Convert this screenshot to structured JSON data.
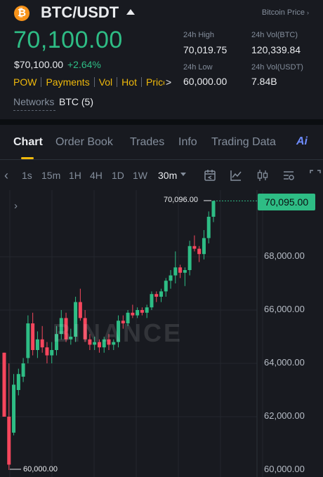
{
  "header": {
    "coin_icon_glyph": "₿",
    "pair": "BTC/USDT",
    "index_label": "Bitcoin Price",
    "last_price": "70,100.00",
    "fiat_price": "$70,100.00",
    "change": "+2.64%",
    "tags": [
      "POW",
      "Payments",
      "Vol",
      "Hot",
      "Price P"
    ],
    "networks_label": "Networks",
    "networks_value": "BTC (5)"
  },
  "stats": {
    "high_label": "24h High",
    "high": "70,019.75",
    "vol_btc_label": "24h Vol(BTC)",
    "vol_btc": "120,339.84",
    "low_label": "24h Low",
    "low": "60,000.00",
    "vol_usdt_label": "24h Vol(USDT)",
    "vol_usdt": "7.84B"
  },
  "tabs": [
    "Chart",
    "Order Book",
    "Trades",
    "Info",
    "Trading Data"
  ],
  "active_tab": "Chart",
  "ai_label": "Ai",
  "timeframes": [
    "1s",
    "15m",
    "1H",
    "4H",
    "1D",
    "1W",
    "30m"
  ],
  "selected_timeframe": "30m",
  "toolbar_icons": [
    "chevron-left-icon",
    "calendar-icon",
    "indicator-icon",
    "candle-type-icon",
    "settings-icon",
    "fullscreen-icon"
  ],
  "colors": {
    "up": "#2ebd85",
    "down": "#f6465d",
    "accent": "#f0b90b",
    "bg": "#181a20"
  },
  "watermark": "BINANCE",
  "chart_data": {
    "type": "candlestick",
    "y_ticks": [
      "68,000.00",
      "66,000.00",
      "64,000.00",
      "62,000.00",
      "60,000.00"
    ],
    "ylim": [
      60000,
      70400
    ],
    "current_price": "70,095.00",
    "high_annotation": "70,096.00",
    "low_annotation": "60,000.00",
    "candles": [
      [
        64400,
        64400,
        62800,
        62000
      ],
      [
        62000,
        64000,
        60000,
        60200
      ],
      [
        61400,
        63600,
        61300,
        63200
      ],
      [
        63000,
        63800,
        62800,
        63600
      ],
      [
        63500,
        64200,
        63300,
        64000
      ],
      [
        64200,
        65800,
        64000,
        65500
      ],
      [
        65500,
        65900,
        64300,
        64500
      ],
      [
        64500,
        65200,
        64200,
        64900
      ],
      [
        64900,
        65400,
        64400,
        64600
      ],
      [
        64600,
        64800,
        64000,
        64300
      ],
      [
        64300,
        64800,
        64000,
        64500
      ],
      [
        64500,
        65400,
        64300,
        65100
      ],
      [
        65100,
        66000,
        64900,
        65700
      ],
      [
        65700,
        65900,
        64800,
        64900
      ],
      [
        64900,
        65300,
        64700,
        65000
      ],
      [
        65000,
        66500,
        64800,
        66300
      ],
      [
        66300,
        66800,
        65600,
        65700
      ],
      [
        65700,
        66000,
        64800,
        64900
      ],
      [
        64900,
        65100,
        64500,
        64700
      ],
      [
        64700,
        65000,
        64500,
        64800
      ],
      [
        64800,
        64900,
        64400,
        64600
      ],
      [
        64600,
        65000,
        64400,
        64900
      ],
      [
        64900,
        65100,
        64500,
        64700
      ],
      [
        64700,
        64900,
        64500,
        64800
      ],
      [
        64800,
        65800,
        64600,
        65600
      ],
      [
        65600,
        65800,
        65300,
        65500
      ],
      [
        65500,
        66000,
        65400,
        65900
      ],
      [
        65900,
        66200,
        65700,
        65800
      ],
      [
        65800,
        66100,
        65700,
        66000
      ],
      [
        66000,
        66100,
        65800,
        65900
      ],
      [
        65900,
        66200,
        65700,
        66100
      ],
      [
        66100,
        66700,
        66000,
        66600
      ],
      [
        66600,
        66700,
        66300,
        66500
      ],
      [
        66500,
        66800,
        66300,
        66700
      ],
      [
        66700,
        67200,
        66500,
        67100
      ],
      [
        67100,
        67500,
        66800,
        67300
      ],
      [
        67300,
        68200,
        67000,
        67600
      ],
      [
        67600,
        67700,
        67200,
        67400
      ],
      [
        67400,
        67600,
        66900,
        67500
      ],
      [
        67500,
        68600,
        67300,
        68400
      ],
      [
        68400,
        68800,
        68200,
        68300
      ],
      [
        68300,
        68400,
        67800,
        68100
      ],
      [
        68100,
        69000,
        67900,
        68700
      ],
      [
        68700,
        69700,
        68500,
        69500
      ],
      [
        69500,
        70096,
        69300,
        70095
      ]
    ]
  }
}
